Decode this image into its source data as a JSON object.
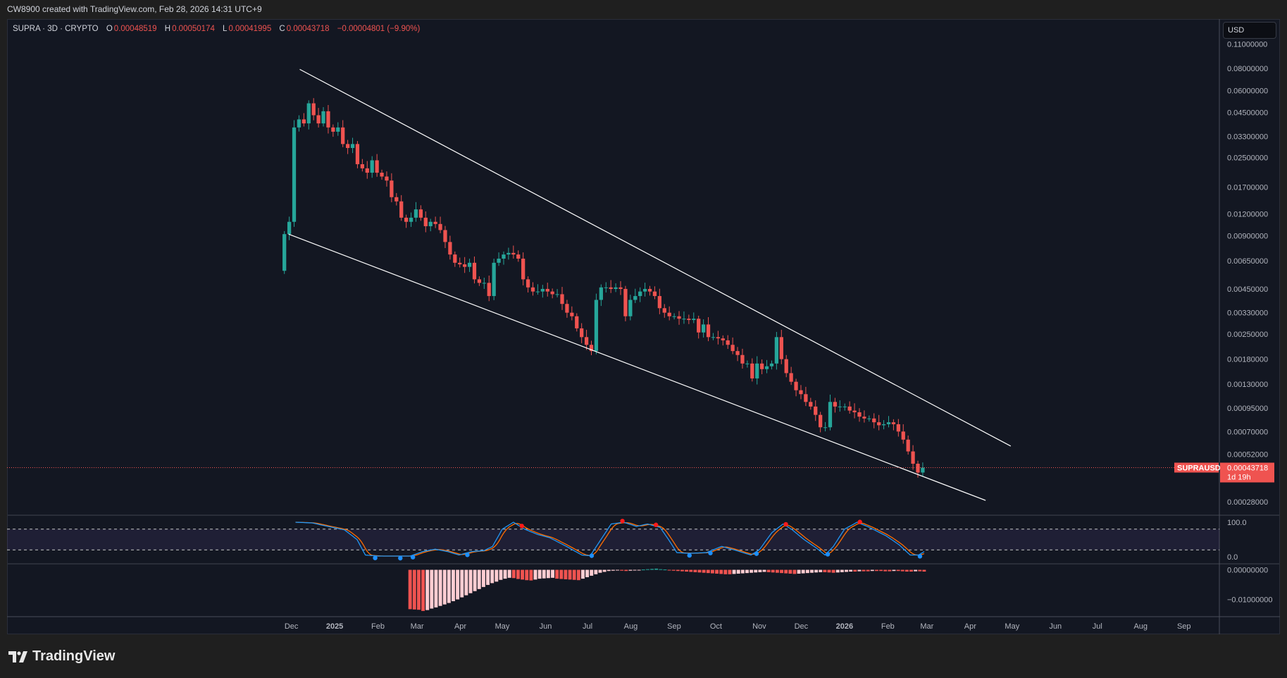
{
  "header": {
    "created_text": "CW8900 created with TradingView.com, Feb 28, 2026 14:31 UTC+9"
  },
  "legend": {
    "symbol": "SUPRA · 3D · CRYPTO",
    "o_label": "O",
    "o": "0.00048519",
    "h_label": "H",
    "h": "0.00050174",
    "l_label": "L",
    "l": "0.00041995",
    "c_label": "C",
    "c": "0.00043718",
    "change": "−0.00004801 (−9.90%)"
  },
  "currency_button": "USD",
  "footer": {
    "brand": "TradingView"
  },
  "colors": {
    "up": "#26a69a",
    "down": "#ef5350",
    "stoch_k": "#2196f3",
    "stoch_d": "#ff6d00",
    "hist_fall": "#ef5350",
    "hist_rise": "#ffcdd2",
    "hist_pos": "#26a69a",
    "line": "#ffffff"
  },
  "chart_data": [
    {
      "type": "candlestick",
      "title": "SUPRA · 3D · CRYPTO",
      "scale": "log",
      "first_open": 0.0057,
      "first_date": "2024-11-26",
      "last_date": "2026-02-26",
      "closes": [
        0.0092,
        0.0108,
        0.037,
        0.0411,
        0.039,
        0.0507,
        0.0434,
        0.039,
        0.0457,
        0.037,
        0.035,
        0.037,
        0.0298,
        0.0283,
        0.0298,
        0.0229,
        0.0217,
        0.0205,
        0.0241,
        0.0205,
        0.0195,
        0.0185,
        0.0149,
        0.0141,
        0.0114,
        0.0108,
        0.0114,
        0.0127,
        0.0114,
        0.0102,
        0.0108,
        0.0105,
        0.0097,
        0.0083,
        0.00705,
        0.00633,
        0.0062,
        0.006,
        0.00633,
        0.0051,
        0.00487,
        0.00487,
        0.0041,
        0.00633,
        0.00668,
        0.00705,
        0.0072,
        0.00705,
        0.00668,
        0.0051,
        0.00459,
        0.00435,
        0.00435,
        0.0045,
        0.00435,
        0.0042,
        0.0042,
        0.0037,
        0.0033,
        0.00315,
        0.00269,
        0.0024,
        0.00217,
        0.002,
        0.0039,
        0.00459,
        0.00459,
        0.0045,
        0.00459,
        0.0045,
        0.00315,
        0.0039,
        0.0041,
        0.00435,
        0.0045,
        0.00435,
        0.0041,
        0.0035,
        0.0033,
        0.00315,
        0.00315,
        0.00305,
        0.00305,
        0.003,
        0.00305,
        0.00255,
        0.00283,
        0.0024,
        0.0024,
        0.00236,
        0.0023,
        0.00217,
        0.002,
        0.0019,
        0.0017,
        0.0017,
        0.0014,
        0.0017,
        0.00158,
        0.00164,
        0.0017,
        0.0024,
        0.0018,
        0.0015,
        0.00134,
        0.0012,
        0.00114,
        0.00103,
        0.00097,
        0.00087,
        0.00074,
        0.00074,
        0.00103,
        0.00097,
        0.00097,
        0.00097,
        0.00092,
        0.0009,
        0.00085,
        0.00083,
        0.00083,
        0.00079,
        0.00076,
        0.00077,
        0.00079,
        0.00077,
        0.0007,
        0.00063,
        0.00054,
        0.00046,
        0.00041,
        0.00043718
      ],
      "y_ticks": [
        "0.11000000",
        "0.08000000",
        "0.06000000",
        "0.04500000",
        "0.03300000",
        "0.02500000",
        "0.01700000",
        "0.01200000",
        "0.00900000",
        "0.00650000",
        "0.00450000",
        "0.00330000",
        "0.00250000",
        "0.00180000",
        "0.00130000",
        "0.00095000",
        "0.00070000",
        "0.00052000",
        "0.00028000"
      ],
      "x_ticks": [
        {
          "label": "Dec",
          "date": "2024-12-01"
        },
        {
          "label": "2025",
          "date": "2025-01-01"
        },
        {
          "label": "Feb",
          "date": "2025-02-01"
        },
        {
          "label": "Mar",
          "date": "2025-03-01"
        },
        {
          "label": "Apr",
          "date": "2025-04-01"
        },
        {
          "label": "May",
          "date": "2025-05-01"
        },
        {
          "label": "Jun",
          "date": "2025-06-01"
        },
        {
          "label": "Jul",
          "date": "2025-07-01"
        },
        {
          "label": "Aug",
          "date": "2025-08-01"
        },
        {
          "label": "Sep",
          "date": "2025-09-01"
        },
        {
          "label": "Oct",
          "date": "2025-10-01"
        },
        {
          "label": "Nov",
          "date": "2025-11-01"
        },
        {
          "label": "Dec",
          "date": "2025-12-01"
        },
        {
          "label": "2026",
          "date": "2026-01-01"
        },
        {
          "label": "Feb",
          "date": "2026-02-01"
        },
        {
          "label": "Mar",
          "date": "2026-03-01"
        },
        {
          "label": "Apr",
          "date": "2026-04-01"
        },
        {
          "label": "May",
          "date": "2026-05-01"
        },
        {
          "label": "Jun",
          "date": "2026-06-01"
        },
        {
          "label": "Jul",
          "date": "2026-07-01"
        },
        {
          "label": "Aug",
          "date": "2026-08-01"
        },
        {
          "label": "Sep",
          "date": "2026-09-01"
        }
      ],
      "trendlines": [
        {
          "name": "upper",
          "from": {
            "date": "2024-12-07",
            "price": 0.079
          },
          "to": {
            "date": "2026-04-30",
            "price": 0.000579
          }
        },
        {
          "name": "lower",
          "from": {
            "date": "2024-11-29",
            "price": 0.0092
          },
          "to": {
            "date": "2026-04-12",
            "price": 0.000285
          }
        }
      ],
      "last_price": {
        "symbol": "SUPRAUSD",
        "price": 0.00043718,
        "label": "0.00043718",
        "countdown": "1d 19h"
      }
    },
    {
      "type": "line",
      "title": "Stochastic RSI",
      "day0": "2024-12-01",
      "ylim": [
        0,
        100
      ],
      "levels": [
        80,
        20
      ],
      "y_ticks": [
        "100.0",
        "0.0"
      ],
      "k_points": [
        [
          3,
          100
        ],
        [
          15,
          98
        ],
        [
          26,
          88
        ],
        [
          38,
          78
        ],
        [
          47,
          50
        ],
        [
          53,
          5
        ],
        [
          62,
          2
        ],
        [
          73,
          2
        ],
        [
          85,
          2
        ],
        [
          94,
          15
        ],
        [
          103,
          22
        ],
        [
          112,
          15
        ],
        [
          120,
          5
        ],
        [
          129,
          15
        ],
        [
          138,
          18
        ],
        [
          144,
          30
        ],
        [
          151,
          80
        ],
        [
          159,
          100
        ],
        [
          167,
          80
        ],
        [
          176,
          65
        ],
        [
          185,
          55
        ],
        [
          197,
          30
        ],
        [
          208,
          5
        ],
        [
          214,
          3
        ],
        [
          220,
          40
        ],
        [
          229,
          95
        ],
        [
          238,
          100
        ],
        [
          247,
          88
        ],
        [
          255,
          95
        ],
        [
          264,
          85
        ],
        [
          270,
          50
        ],
        [
          276,
          12
        ],
        [
          285,
          10
        ],
        [
          297,
          12
        ],
        [
          308,
          30
        ],
        [
          317,
          20
        ],
        [
          329,
          5
        ],
        [
          335,
          20
        ],
        [
          344,
          70
        ],
        [
          352,
          95
        ],
        [
          358,
          80
        ],
        [
          367,
          50
        ],
        [
          376,
          25
        ],
        [
          382,
          5
        ],
        [
          388,
          30
        ],
        [
          396,
          80
        ],
        [
          405,
          100
        ],
        [
          414,
          85
        ],
        [
          426,
          60
        ],
        [
          435,
          35
        ],
        [
          443,
          5
        ],
        [
          449,
          5
        ],
        [
          453,
          15
        ]
      ],
      "overbought_signals_day": [
        165,
        237,
        261,
        354,
        407
      ],
      "oversold_signals_day": [
        60,
        78,
        87,
        126,
        215,
        285,
        300,
        333,
        384,
        450
      ]
    },
    {
      "type": "bar",
      "title": "MACD histogram",
      "first_date": "2025-02-24",
      "last_date": "2026-02-27",
      "y_ticks": [
        {
          "label": "0.00000000",
          "value": 0
        },
        {
          "label": "−0.01000000",
          "value": -0.01
        }
      ],
      "values": [
        -0.0133,
        -0.0134,
        -0.0135,
        -0.0139,
        -0.0136,
        -0.0131,
        -0.0127,
        -0.0122,
        -0.0117,
        -0.0112,
        -0.0106,
        -0.01,
        -0.0093,
        -0.0086,
        -0.0079,
        -0.0072,
        -0.0065,
        -0.0058,
        -0.0051,
        -0.0045,
        -0.004,
        -0.0034,
        -0.003,
        -0.0027,
        -0.0028,
        -0.0031,
        -0.0033,
        -0.0035,
        -0.0036,
        -0.0033,
        -0.003,
        -0.0029,
        -0.0028,
        -0.0027,
        -0.003,
        -0.0031,
        -0.0032,
        -0.0033,
        -0.0034,
        -0.0035,
        -0.003,
        -0.0025,
        -0.002,
        -0.0015,
        -0.001,
        -0.0007,
        -0.0004,
        -0.0003,
        -0.0002,
        -0.0003,
        -0.0004,
        -0.0003,
        -0.0002,
        -0.0001,
        0.0001,
        0.0002,
        0.0003,
        0.0004,
        0.0002,
        0.0001,
        -0.0002,
        -0.0003,
        -0.0004,
        -0.0005,
        -0.0006,
        -0.0007,
        -0.0008,
        -0.0009,
        -0.001,
        -0.0011,
        -0.0012,
        -0.0013,
        -0.0014,
        -0.0015,
        -0.0015,
        -0.0014,
        -0.0013,
        -0.0012,
        -0.0011,
        -0.001,
        -0.0009,
        -0.0008,
        -0.0007,
        -0.0008,
        -0.0009,
        -0.001,
        -0.0011,
        -0.0012,
        -0.0013,
        -0.0014,
        -0.0013,
        -0.0012,
        -0.0011,
        -0.001,
        -0.0009,
        -0.0008,
        -0.0008,
        -0.0009,
        -0.001,
        -0.0009,
        -0.0008,
        -0.0007,
        -0.0006,
        -0.0006,
        -0.0005,
        -0.0005,
        -0.0005,
        -0.0004,
        -0.0004,
        -0.0004,
        -0.0005,
        -0.0005,
        -0.0004,
        -0.0004,
        -0.0005,
        -0.0006,
        -0.0006,
        -0.0005,
        -0.0005,
        -0.0006
      ]
    }
  ]
}
